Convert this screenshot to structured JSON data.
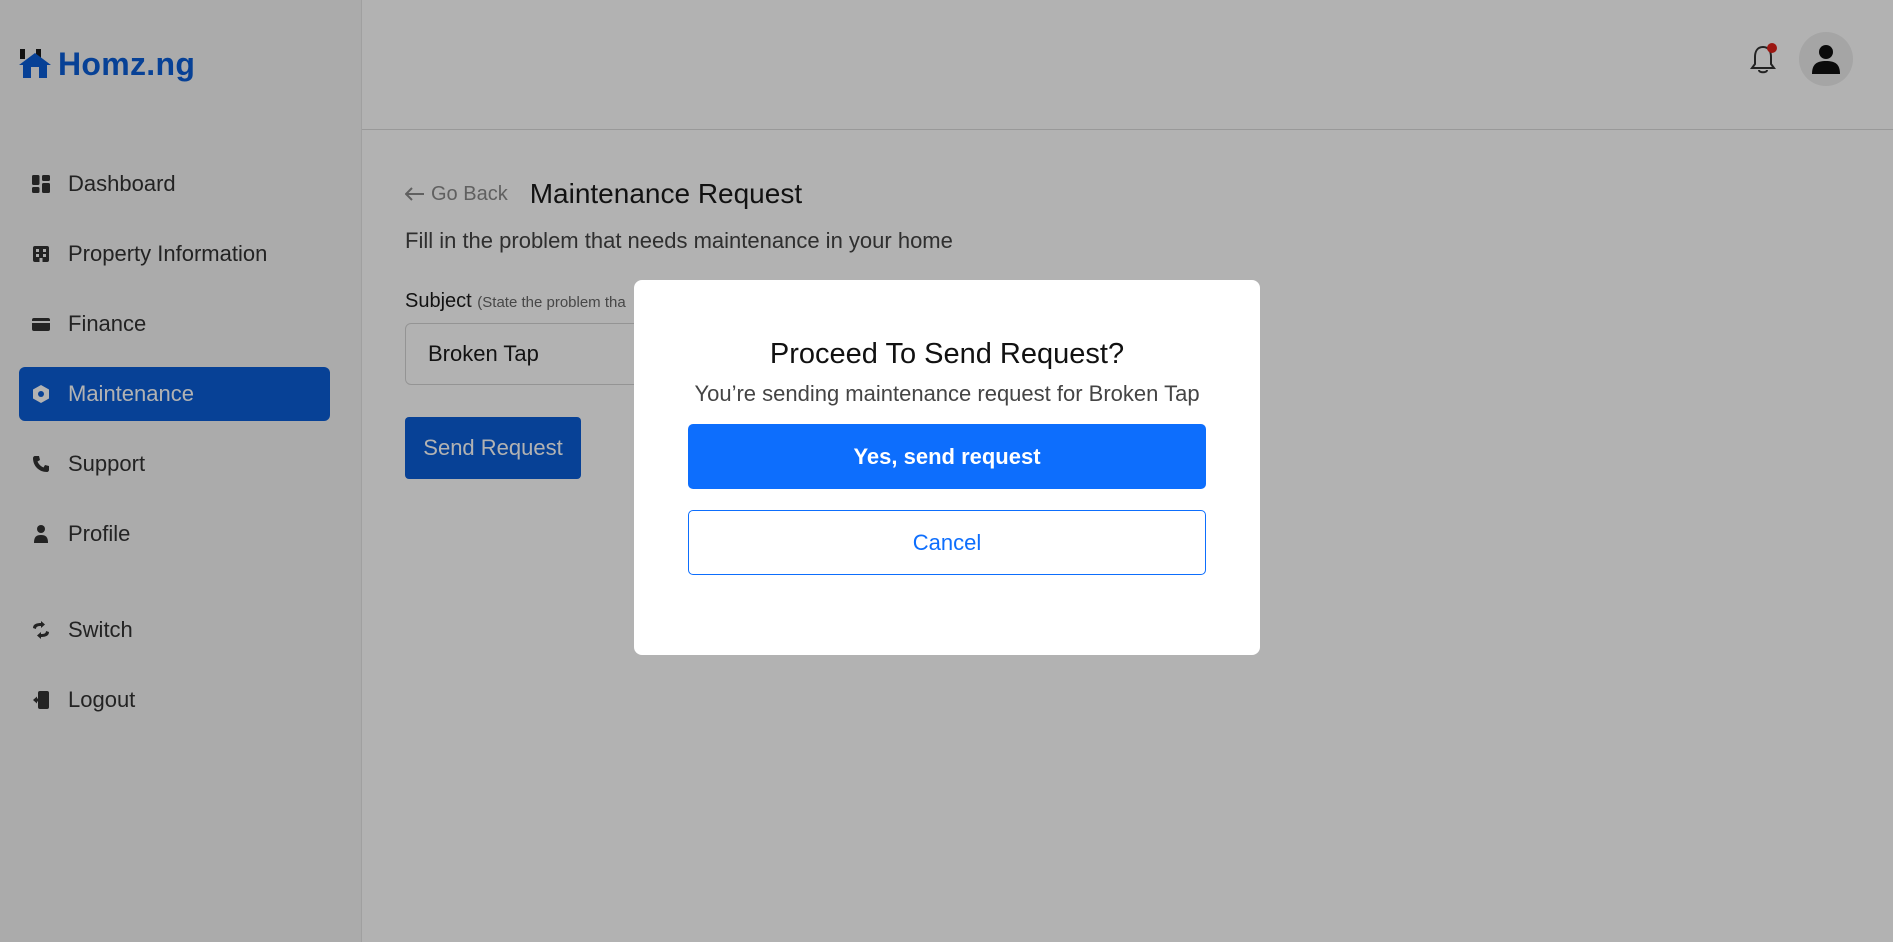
{
  "brand": {
    "name": "Homz.ng",
    "logo_icon": "house-icon",
    "color": "#0b5ed7"
  },
  "sidebar": {
    "items": [
      {
        "label": "Dashboard",
        "icon": "dashboard-icon"
      },
      {
        "label": "Property Information",
        "icon": "building-icon"
      },
      {
        "label": "Finance",
        "icon": "wallet-icon"
      },
      {
        "label": "Maintenance",
        "icon": "gear-icon",
        "active": true
      },
      {
        "label": "Support",
        "icon": "phone-icon"
      },
      {
        "label": "Profile",
        "icon": "user-icon"
      }
    ],
    "bottom_items": [
      {
        "label": "Switch",
        "icon": "switch-icon"
      },
      {
        "label": "Logout",
        "icon": "logout-icon"
      }
    ]
  },
  "header": {
    "notification_icon": "bell-icon",
    "has_notification": true,
    "avatar_icon": "user-icon"
  },
  "main": {
    "go_back": "Go Back",
    "title": "Maintenance Request",
    "subtitle": "Fill in the problem that needs maintenance in your home",
    "subject_label": "Subject",
    "subject_hint": "(State the problem tha",
    "subject_value": "Broken Tap",
    "send_button": "Send Request"
  },
  "modal": {
    "title": "Proceed To Send Request?",
    "message": "You’re sending maintenance request for Broken Tap",
    "confirm_label": "Yes, send request",
    "cancel_label": "Cancel",
    "accent": "#0d6efd"
  }
}
